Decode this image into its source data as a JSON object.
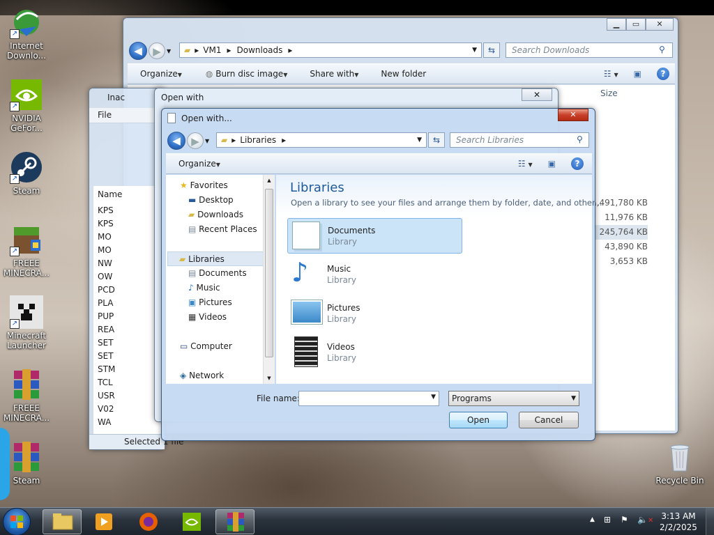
{
  "desktop": {
    "icons": [
      {
        "label": "Internet Downlo..."
      },
      {
        "label": "NVIDIA GeFor..."
      },
      {
        "label": "Steam"
      },
      {
        "label": "FREEE MINECRA..."
      },
      {
        "label": "Minecraft Launcher"
      },
      {
        "label": "FREEE MINECRA..."
      },
      {
        "label": "Steam"
      },
      {
        "label": "Recycle Bin"
      }
    ]
  },
  "explorer": {
    "breadcrumb": [
      "VM1",
      "Downloads"
    ],
    "search_placeholder": "Search Downloads",
    "toolbar": {
      "organize": "Organize",
      "burn": "Burn disc image",
      "share": "Share with",
      "new_folder": "New folder"
    },
    "col_size": "Size",
    "sizes": [
      "5,491,780 KB",
      "11,976 KB",
      "245,764 KB",
      "43,890 KB",
      "3,653 KB"
    ]
  },
  "back_window": {
    "title": "Inac",
    "menu_file": "File",
    "col_name": "Name",
    "rows": [
      "KPS",
      "KPS",
      "MO",
      "MO",
      "NW",
      "OW",
      "PCD",
      "PLA",
      "PUP",
      "REA",
      "SET",
      "SET",
      "STM",
      "TCL",
      "USR",
      "V02",
      "WA"
    ],
    "status": "Selected 1 file"
  },
  "openwith_bg": {
    "title": "Open with"
  },
  "dialog": {
    "title": "Open with...",
    "breadcrumb": [
      "Libraries"
    ],
    "search_placeholder": "Search Libraries",
    "organize": "Organize",
    "nav": {
      "favorites": "Favorites",
      "fav_items": [
        "Desktop",
        "Downloads",
        "Recent Places"
      ],
      "libraries": "Libraries",
      "lib_items": [
        "Documents",
        "Music",
        "Pictures",
        "Videos"
      ],
      "computer": "Computer",
      "network": "Network"
    },
    "heading": "Libraries",
    "subtitle": "Open a library to see your files and arrange them by folder, date, and other...",
    "libraries": [
      {
        "name": "Documents",
        "type": "Library"
      },
      {
        "name": "Music",
        "type": "Library"
      },
      {
        "name": "Pictures",
        "type": "Library"
      },
      {
        "name": "Videos",
        "type": "Library"
      }
    ],
    "filename_label": "File name:",
    "filename_value": "",
    "filter": "Programs",
    "open": "Open",
    "cancel": "Cancel"
  },
  "taskbar": {
    "time": "3:13 AM",
    "date": "2/2/2025"
  }
}
